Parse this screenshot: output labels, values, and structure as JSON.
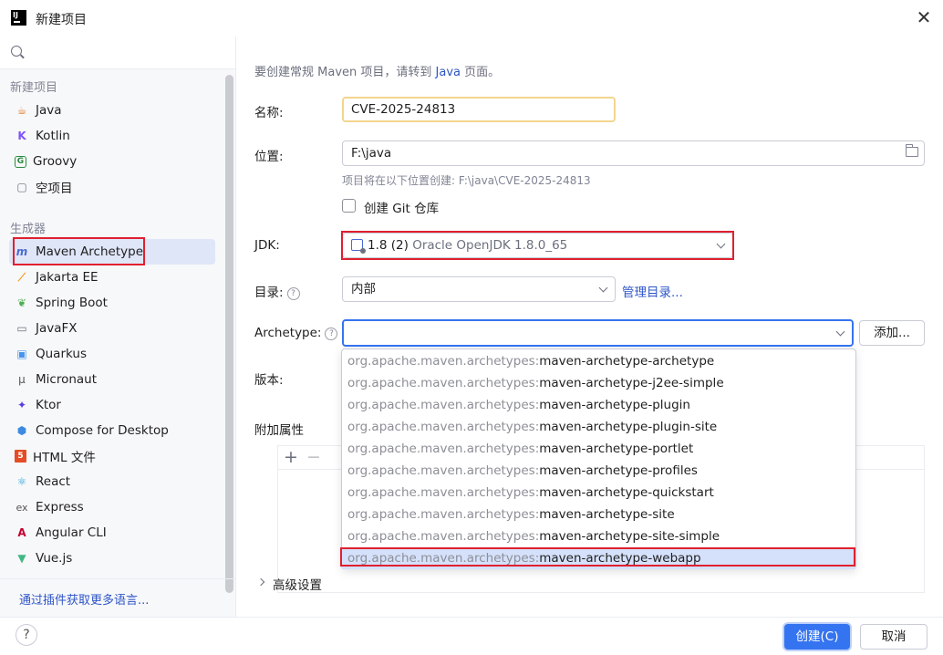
{
  "window": {
    "title": "新建项目",
    "logo": "IJ",
    "colors": {
      "accent": "#3574f0",
      "highlight": "#e0202e"
    }
  },
  "sidebar": {
    "search_placeholder": "",
    "section_new": "新建项目",
    "new_items": [
      {
        "label": "Java",
        "icon": "java-icon"
      },
      {
        "label": "Kotlin",
        "icon": "kotlin-icon"
      },
      {
        "label": "Groovy",
        "icon": "groovy-icon"
      },
      {
        "label": "空项目",
        "icon": "empty-project-icon"
      }
    ],
    "section_generators": "生成器",
    "generator_items": [
      {
        "label": "Maven Archetype",
        "icon": "maven-icon",
        "selected": true
      },
      {
        "label": "Jakarta EE",
        "icon": "jakarta-icon"
      },
      {
        "label": "Spring Boot",
        "icon": "spring-icon"
      },
      {
        "label": "JavaFX",
        "icon": "javafx-icon"
      },
      {
        "label": "Quarkus",
        "icon": "quarkus-icon"
      },
      {
        "label": "Micronaut",
        "icon": "micronaut-icon"
      },
      {
        "label": "Ktor",
        "icon": "ktor-icon"
      },
      {
        "label": "Compose for Desktop",
        "icon": "compose-icon"
      },
      {
        "label": "HTML 文件",
        "icon": "html-icon"
      },
      {
        "label": "React",
        "icon": "react-icon"
      },
      {
        "label": "Express",
        "icon": "express-icon"
      },
      {
        "label": "Angular CLI",
        "icon": "angular-icon"
      },
      {
        "label": "Vue.js",
        "icon": "vue-icon"
      }
    ],
    "plugins_link": "通过插件获取更多语言..."
  },
  "form": {
    "hint_prefix": "要创建常规 Maven 项目，请转到",
    "hint_link": "Java",
    "hint_suffix": "页面。",
    "name_label": "名称:",
    "name_value": "CVE-2025-24813",
    "location_label": "位置:",
    "location_value": "F:\\java",
    "location_hint": "项目将在以下位置创建: F:\\java\\CVE-2025-24813",
    "git_label": "创建 Git 仓库",
    "jdk_label": "JDK:",
    "jdk_version": "1.8 (2)",
    "jdk_name": "Oracle OpenJDK 1.8.0_65",
    "catalog_label": "目录:",
    "catalog_value": "内部",
    "manage_catalog": "管理目录...",
    "archetype_label": "Archetype:",
    "archetype_value": "",
    "add_button": "添加...",
    "version_label": "版本:",
    "props_label": "附加属性",
    "add_tool": "+",
    "remove_tool": "−",
    "advanced": "高级设置"
  },
  "archetype_options": [
    {
      "group": "org.apache.maven.archetypes:",
      "artifact": "maven-archetype-archetype"
    },
    {
      "group": "org.apache.maven.archetypes:",
      "artifact": "maven-archetype-j2ee-simple"
    },
    {
      "group": "org.apache.maven.archetypes:",
      "artifact": "maven-archetype-plugin"
    },
    {
      "group": "org.apache.maven.archetypes:",
      "artifact": "maven-archetype-plugin-site"
    },
    {
      "group": "org.apache.maven.archetypes:",
      "artifact": "maven-archetype-portlet"
    },
    {
      "group": "org.apache.maven.archetypes:",
      "artifact": "maven-archetype-profiles"
    },
    {
      "group": "org.apache.maven.archetypes:",
      "artifact": "maven-archetype-quickstart"
    },
    {
      "group": "org.apache.maven.archetypes:",
      "artifact": "maven-archetype-site"
    },
    {
      "group": "org.apache.maven.archetypes:",
      "artifact": "maven-archetype-site-simple"
    },
    {
      "group": "org.apache.maven.archetypes:",
      "artifact": "maven-archetype-webapp",
      "selected": true
    }
  ],
  "footer": {
    "help": "?",
    "create": "创建(C)",
    "cancel": "取消"
  }
}
